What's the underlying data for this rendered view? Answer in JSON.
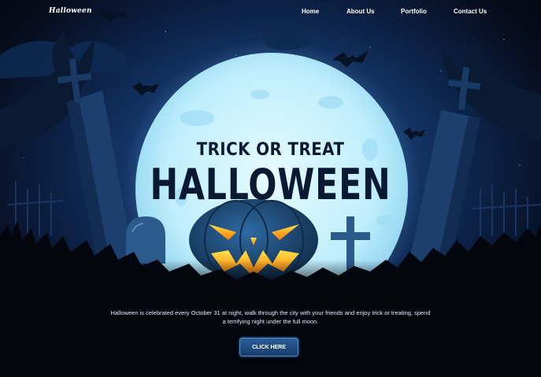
{
  "nav": {
    "logo": "Halloween",
    "links": [
      "Home",
      "About Us",
      "Portfolio",
      "Contact Us"
    ]
  },
  "hero": {
    "subtitle": "TRICK OR TREAT",
    "title": "HALLOWEEN",
    "description": "Halloween is celebrated every October 31 at night, walk through the city with your friends and enjoy trick or treating, spend a terrifying night under the full moon.",
    "cta_label": "CLICK HERE"
  },
  "colors": {
    "moon": "#bfeefc",
    "pumpkin": "#1f4a78",
    "pumpkin_glow": "#ffb000",
    "sky": "#173d74",
    "button": "#2c5f9b"
  },
  "icons": [
    "bat-icon",
    "pumpkin-icon",
    "moon-icon",
    "tombstone-icon",
    "cross-icon",
    "tree-icon"
  ]
}
